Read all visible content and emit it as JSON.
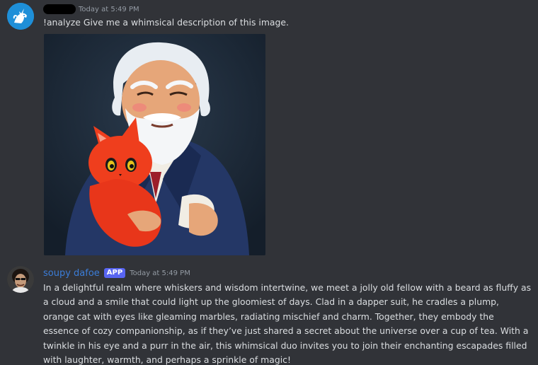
{
  "message1": {
    "timestamp": "Today at 5:49 PM",
    "text": "!analyze Give me a whimsical description of this image.",
    "avatar_icon": "unicorn-icon"
  },
  "message2": {
    "username": "soupy dafoe",
    "badge": "APP",
    "timestamp": "Today at 5:49 PM",
    "text": "In a delightful realm where whiskers and wisdom intertwine, we meet a jolly old fellow with a beard as fluffy as a cloud and a smile that could light up the gloomiest of days. Clad in a dapper suit, he cradles a plump, orange cat with eyes like gleaming marbles, radiating mischief and charm. Together, they embody the essence of cozy companionship, as if they’ve just shared a secret about the universe over a cup of tea. With a twinkle in his eye and a purr in the air, this whimsical duo invites you to join their enchanting escapades filled with laughter, warmth, and perhaps a sprinkle of magic!",
    "avatar_icon": "bot-avatar-icon"
  },
  "colors": {
    "background": "#313338",
    "username": "#3b7dd8",
    "badge": "#5865f2",
    "timestamp": "#949ba4"
  }
}
